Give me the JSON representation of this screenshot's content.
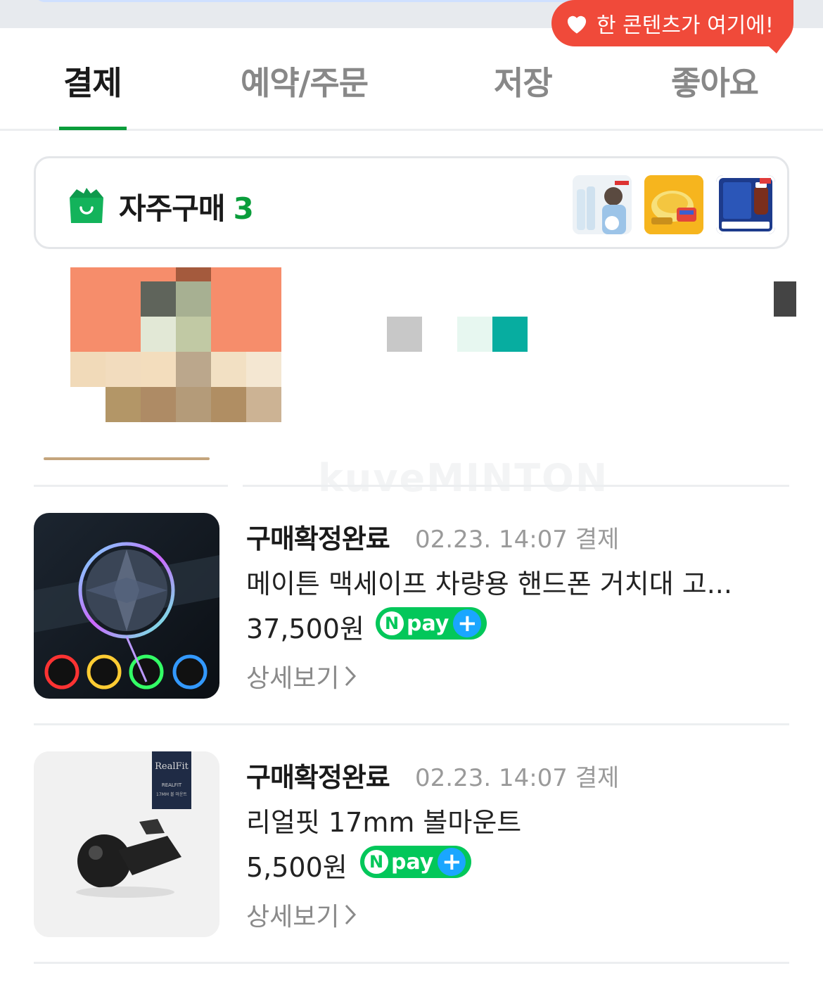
{
  "tooltip": {
    "icon": "heart-icon",
    "text": "한 콘텐츠가 여기에!"
  },
  "tabs": [
    {
      "label": "결제",
      "active": true
    },
    {
      "label": "예약/주문",
      "active": false
    },
    {
      "label": "저장",
      "active": false
    },
    {
      "label": "좋아요",
      "active": false
    }
  ],
  "frequent": {
    "title": "자주구매",
    "count": "3",
    "icon": "shopping-bag-icon"
  },
  "watermark": "kuveMINTON",
  "orders": [
    {
      "status": "구매확정완료",
      "date": "02.23. 14:07 결제",
      "name": "메이튼 맥세이프 차량용 핸드폰 거치대 고...",
      "price": "37,500원",
      "npay": "pay",
      "detail": "상세보기"
    },
    {
      "status": "구매확정완료",
      "date": "02.23. 14:07 결제",
      "name": "리얼핏 17mm 볼마운트",
      "price": "5,500원",
      "npay": "pay",
      "detail": "상세보기",
      "box_brand": "RealFit",
      "box_sub": "REALFIT",
      "box_line": "17MM 볼 마운트"
    }
  ],
  "colors": {
    "accent_green": "#0a9d3b",
    "tooltip_red": "#f04a3a",
    "npay_green": "#03c75a"
  }
}
